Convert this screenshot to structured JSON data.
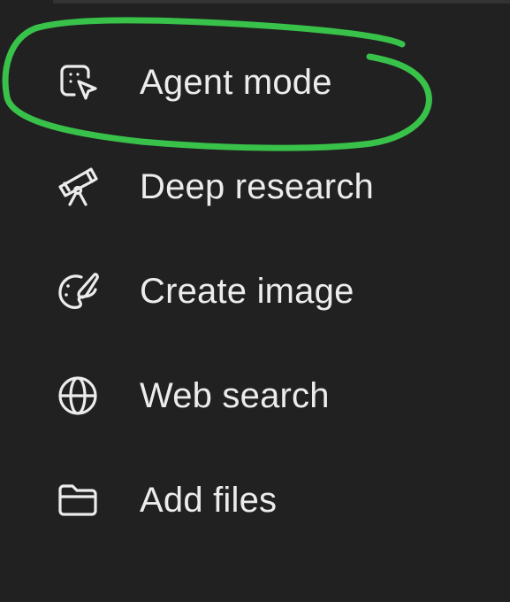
{
  "menu": {
    "items": [
      {
        "label": "Agent mode",
        "icon": "agent-cursor-icon"
      },
      {
        "label": "Deep research",
        "icon": "telescope-icon"
      },
      {
        "label": "Create image",
        "icon": "paint-palette-icon"
      },
      {
        "label": "Web search",
        "icon": "globe-icon"
      },
      {
        "label": "Add files",
        "icon": "folder-icon"
      }
    ]
  },
  "colors": {
    "background": "#212121",
    "text": "#ececec",
    "annotation": "#38c24a"
  }
}
